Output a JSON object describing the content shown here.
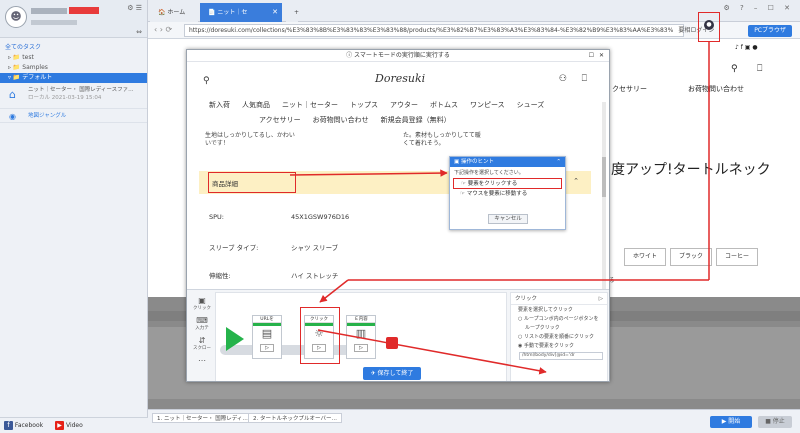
{
  "tree": {
    "title": "全てのタスク",
    "items": [
      "test",
      "Samples",
      "デフォルト"
    ]
  },
  "tasks": [
    {
      "name": "ニット｜セーター・ 国際レディースファ…",
      "meta": "ローカル",
      "date": "2021-03-19 15:04"
    },
    {
      "name": "地図ジャングル",
      "meta": "",
      "date": ""
    }
  ],
  "footer": {
    "facebook": "Facebook",
    "video": "Video"
  },
  "tabs": {
    "home": "ホーム",
    "page": "ニット｜セ"
  },
  "address": {
    "url": "https://doresuki.com/collections/%E3%83%8B%E3%83%83%E3%83%88/products/%E3%82%B7%E3%83%A3%E3%83%84-%E3%82%B9%E3%83%AA%E3%83%",
    "browser_mode": "PCブラウザ",
    "login": "要相ログイン"
  },
  "modal": {
    "title": "スマートモードの実行順に実行する",
    "logo": "Doresuki",
    "menu1": [
      "新入荷",
      "人気商品",
      "ニット｜セーター",
      "トップス",
      "アウター",
      "ボトムス",
      "ワンピース",
      "シューズ"
    ],
    "menu2": [
      "アクセサリー",
      "お荷物問い合わせ",
      "新規会員登録（無料）"
    ],
    "desc_left": "生地はしっかりしてるし、かわいいです！",
    "desc_right": "た。素材もしっかりしてて暖くて着れそう。",
    "detail_label": "商品詳細",
    "specs": [
      {
        "label": "SPU:",
        "value": "45X1GSW976D16"
      },
      {
        "label": "スリーブ タイプ:",
        "value": "シャツ スリーブ"
      },
      {
        "label": "伸縮性:",
        "value": "ハイ ストレッチ"
      }
    ]
  },
  "hint": {
    "title": "操作のヒント",
    "subtitle": "下記操作を選択してください。",
    "opt_click": "要素をクリックする",
    "opt_hover": "マウスを要素に移動する",
    "cancel": "キャンセル"
  },
  "flow": {
    "tools": [
      "クリック",
      "入力テ",
      "スクロー"
    ],
    "blocks": [
      "URLを",
      "クリック",
      "Ｅ内容"
    ],
    "cfg_title": "クリック",
    "cfg_lines": [
      "要素を選択してクリック",
      "ループコンボ内のページボタンを",
      "ループクリック",
      "リストの要素を順番にクリック",
      "手動で要素をクリック"
    ],
    "xpath": "/html/body/div[@id='dr"
  },
  "save": "保存して終了",
  "bg": {
    "big": "度アップ!タートルネック",
    "access": "クセサリー",
    "inquiry": "お荷物問い合わせ",
    "colors": [
      "ホワイト",
      "ブラック",
      "コーヒー"
    ],
    "bottom_tab1": "1. ニット｜セーター・ 国際レディ…",
    "bottom_tab2": "2. タートルネックプルオーバー…",
    "start": "▶ 開始",
    "stop": "■ 停止"
  }
}
